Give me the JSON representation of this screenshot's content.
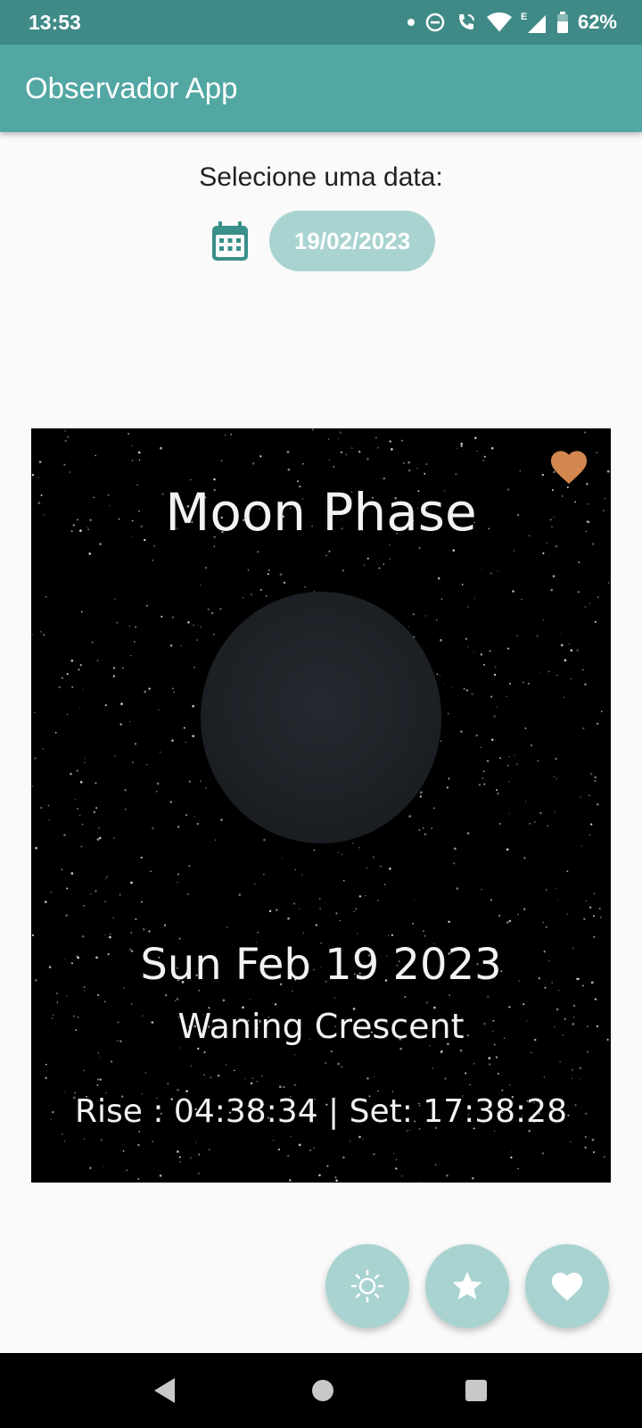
{
  "status_bar": {
    "time": "13:53",
    "battery": "62%"
  },
  "app_bar": {
    "title": "Observador App"
  },
  "date_picker": {
    "label": "Selecione uma data:",
    "date_value": "19/02/2023",
    "icon": "calendar-icon"
  },
  "moon_card": {
    "title": "Moon Phase",
    "date": "Sun Feb 19 2023",
    "phase": "Waning Crescent",
    "times": "Rise : 04:38:34 | Set: 17:38:28",
    "favorite_icon": "heart-icon",
    "favorite_color": "#d2874f"
  },
  "fabs": [
    {
      "icon": "sun-icon"
    },
    {
      "icon": "star-icon"
    },
    {
      "icon": "heart-icon"
    }
  ],
  "nav": {
    "back": "back-icon",
    "home": "home-icon",
    "recents": "recents-icon"
  },
  "colors": {
    "status": "#3f8a86",
    "primary": "#52a7a3",
    "accent_light": "#a9d3d1",
    "teal_icon": "#3a8f8a"
  }
}
